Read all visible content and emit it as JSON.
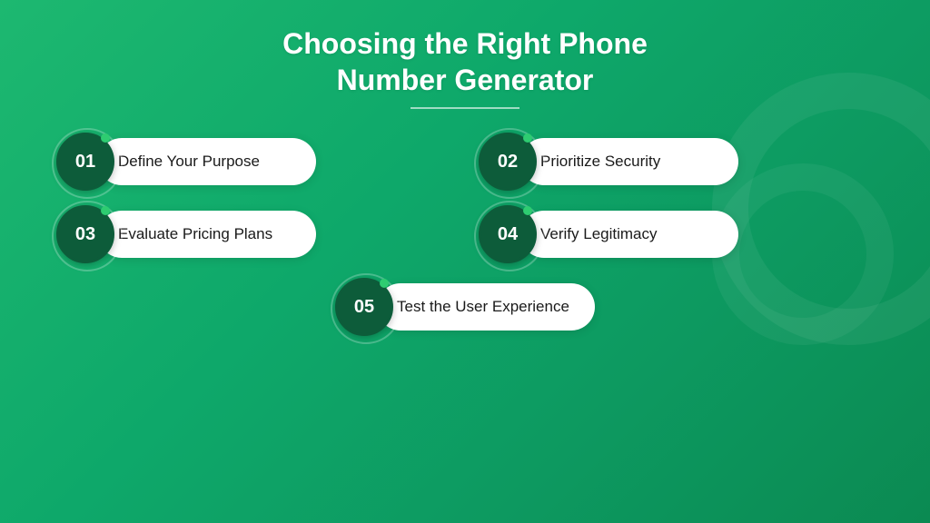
{
  "page": {
    "title_line1": "Choosing the Right Phone",
    "title_line2": "Number Generator"
  },
  "steps": [
    {
      "id": "01",
      "label": "Define Your Purpose"
    },
    {
      "id": "02",
      "label": "Prioritize Security"
    },
    {
      "id": "03",
      "label": "Evaluate Pricing Plans"
    },
    {
      "id": "04",
      "label": "Verify Legitimacy"
    },
    {
      "id": "05",
      "label": "Test the User Experience"
    }
  ]
}
